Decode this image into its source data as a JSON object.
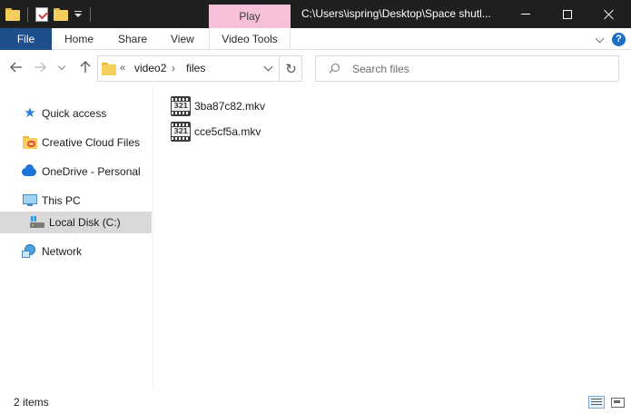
{
  "window": {
    "title": "C:\\Users\\ispring\\Desktop\\Space shutl...",
    "contextual_tab_group": "Play"
  },
  "ribbon": {
    "tabs": [
      {
        "label": "File",
        "active": true
      },
      {
        "label": "Home"
      },
      {
        "label": "Share"
      },
      {
        "label": "View"
      },
      {
        "label": "Video Tools"
      }
    ],
    "help_label": "?"
  },
  "navigation": {
    "breadcrumb_overflow": "«",
    "breadcrumb": [
      "video2",
      "files"
    ],
    "breadcrumb_separator": "›",
    "refresh_glyph": "↻"
  },
  "search": {
    "placeholder": "Search files"
  },
  "sidebar": {
    "items": [
      {
        "label": "Quick access",
        "icon": "quick-access-star-icon"
      },
      {
        "label": "Creative Cloud Files",
        "icon": "creative-cloud-folder-icon"
      },
      {
        "label": "OneDrive - Personal",
        "icon": "onedrive-cloud-icon"
      },
      {
        "label": "This PC",
        "icon": "this-pc-icon"
      },
      {
        "label": "Local Disk (C:)",
        "icon": "local-disk-icon",
        "selected": true
      },
      {
        "label": "Network",
        "icon": "network-icon"
      }
    ]
  },
  "files": [
    {
      "name": "3ba87c82.mkv",
      "icon": "mkv-file-icon",
      "icon_text": "321"
    },
    {
      "name": "cce5cf5a.mkv",
      "icon": "mkv-file-icon",
      "icon_text": "321"
    }
  ],
  "status": {
    "item_count": "2 items"
  },
  "colors": {
    "title_bar": "#1f1f1f",
    "file_tab": "#1f4e8c",
    "play_tab": "#f7c0d9",
    "selected_item": "#d9d9d9"
  }
}
